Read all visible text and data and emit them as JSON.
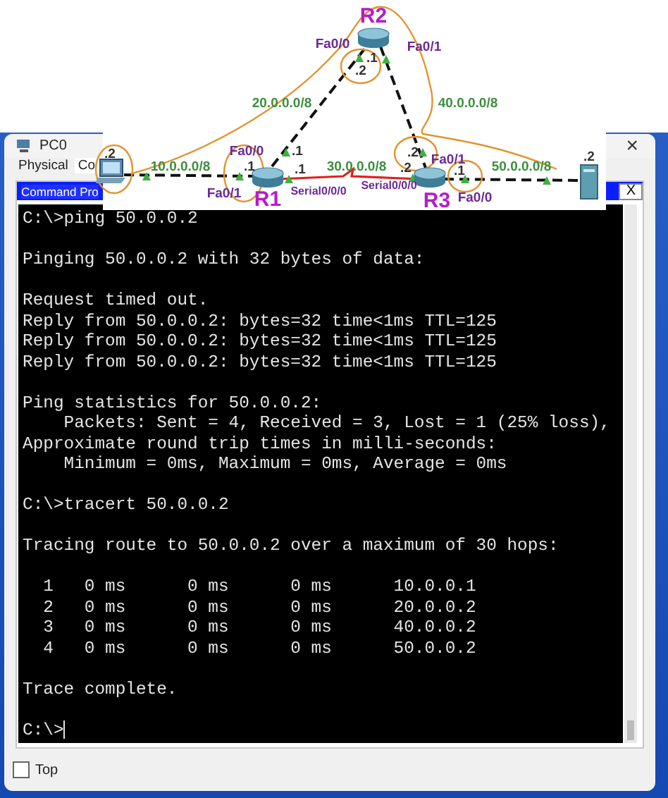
{
  "topology": {
    "devices": [
      {
        "kind": "router",
        "name": "R2"
      },
      {
        "kind": "router",
        "name": "R1"
      },
      {
        "kind": "router",
        "name": "R3"
      },
      {
        "kind": "pc"
      },
      {
        "kind": "server"
      }
    ],
    "texts": [
      {
        "kind": "interface",
        "text": "Fa0/0"
      },
      {
        "kind": "interface",
        "text": "Fa0/1"
      },
      {
        "kind": "address",
        "text": ".2"
      },
      {
        "kind": "address",
        "text": ".1"
      },
      {
        "kind": "network",
        "text": "20.0.0.0/8"
      },
      {
        "kind": "network",
        "text": "40.0.0.0/8"
      },
      {
        "kind": "address",
        "text": ".2"
      },
      {
        "kind": "network",
        "text": "10.0.0.0/8"
      },
      {
        "kind": "interface",
        "text": "Fa0/0"
      },
      {
        "kind": "address",
        "text": ".1"
      },
      {
        "kind": "address",
        "text": ".1"
      },
      {
        "kind": "address",
        "text": ".1"
      },
      {
        "kind": "interface",
        "text": "Fa0/1"
      },
      {
        "kind": "interface",
        "text": "Serial0/0/0"
      },
      {
        "kind": "network",
        "text": "30.0.0.0/8"
      },
      {
        "kind": "interface",
        "text": "Serial0/0/0"
      },
      {
        "kind": "address",
        "text": ".2"
      },
      {
        "kind": "address",
        "text": ".2"
      },
      {
        "kind": "interface",
        "text": "Fa0/1"
      },
      {
        "kind": "address",
        "text": ".1"
      },
      {
        "kind": "interface",
        "text": "Fa0/0"
      },
      {
        "kind": "network",
        "text": "50.0.0.0/8"
      },
      {
        "kind": "address",
        "text": ".2"
      }
    ],
    "links": [
      {
        "kind": "ethernet"
      },
      {
        "kind": "ethernet"
      },
      {
        "kind": "ethernet"
      },
      {
        "kind": "serial"
      },
      {
        "kind": "ethernet"
      }
    ]
  },
  "window": {
    "title": "PC0",
    "close": "×"
  },
  "tabs": [
    {
      "label": "Physical",
      "selected": false
    },
    {
      "label": "Co",
      "selected": true
    }
  ],
  "command_prompt": {
    "title": "Command Pro",
    "close": "X",
    "blocks": [
      [
        "C:\\>ping 50.0.0.2"
      ],
      [
        "Pinging 50.0.0.2 with 32 bytes of data:"
      ],
      [
        "Request timed out.",
        "Reply from 50.0.0.2: bytes=32 time<1ms TTL=125",
        "Reply from 50.0.0.2: bytes=32 time<1ms TTL=125",
        "Reply from 50.0.0.2: bytes=32 time<1ms TTL=125"
      ],
      [
        "Ping statistics for 50.0.0.2:",
        "    Packets: Sent = 4, Received = 3, Lost = 1 (25% loss),",
        "Approximate round trip times in milli-seconds:",
        "    Minimum = 0ms, Maximum = 0ms, Average = 0ms"
      ],
      [
        "C:\\>tracert 50.0.0.2"
      ],
      [
        "Tracing route to 50.0.0.2 over a maximum of 30 hops:"
      ],
      [
        "  1   0 ms      0 ms      0 ms      10.0.0.1",
        "  2   0 ms      0 ms      0 ms      20.0.0.2",
        "  3   0 ms      0 ms      0 ms      40.0.0.2",
        "  4   0 ms      0 ms      0 ms      50.0.0.2"
      ],
      [
        "Trace complete."
      ],
      [
        "C:\\>"
      ]
    ]
  },
  "top_checkbox": {
    "label": "Top",
    "checked": false
  }
}
